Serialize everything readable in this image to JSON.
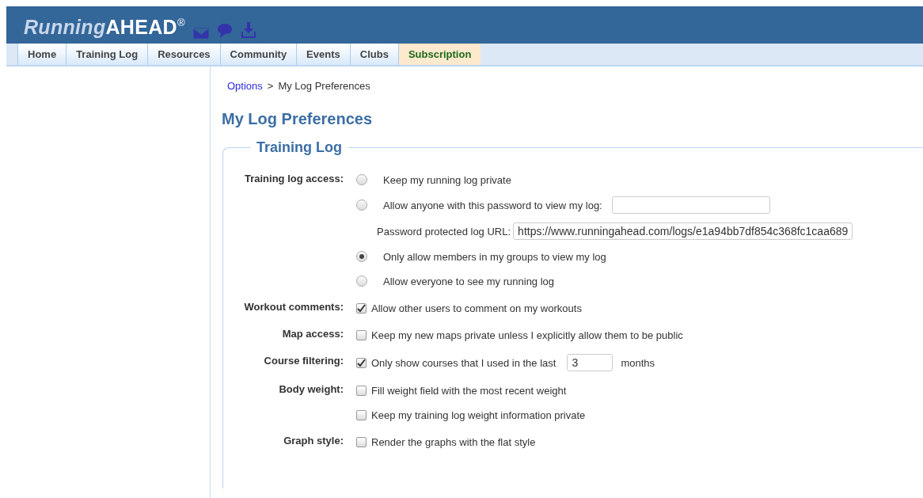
{
  "header": {
    "logo": {
      "first": "Running",
      "second": "AHEAD",
      "mark": "®"
    }
  },
  "nav": [
    {
      "label": "Home",
      "kind": "tab"
    },
    {
      "label": "Training Log",
      "kind": "tab"
    },
    {
      "label": "Resources",
      "kind": "tab"
    },
    {
      "label": "Community",
      "kind": "tab"
    },
    {
      "label": "Events",
      "kind": "tab"
    },
    {
      "label": "Clubs",
      "kind": "tab"
    },
    {
      "label": "Subscription",
      "kind": "promo"
    }
  ],
  "breadcrumb": {
    "link": "Options",
    "separator": ">",
    "current": "My Log Preferences"
  },
  "title": "My Log Preferences",
  "section": {
    "legend": "Training Log",
    "rows": [
      {
        "label": "Training log access:",
        "options": [
          {
            "kind": "radio",
            "text": "Keep my running log private",
            "selected": false
          },
          {
            "kind": "radio_field",
            "text": "Allow anyone with this password to view my log:",
            "selected": false
          },
          {
            "kind": "url",
            "text": "Password protected log URL:",
            "value": "https://www.runningahead.com/logs/e1a94bb7df854c368fc1caa689"
          },
          {
            "kind": "radio",
            "text": "Only allow members in my groups to view my log",
            "selected": true
          },
          {
            "kind": "radio",
            "text": "Allow everyone to see my running log",
            "selected": false
          }
        ]
      },
      {
        "label": "Workout comments:",
        "options": [
          {
            "kind": "checkbox",
            "text": "Allow other users to comment on my workouts",
            "checked": true
          }
        ]
      },
      {
        "label": "Map access:",
        "options": [
          {
            "kind": "checkbox",
            "text": "Keep my new maps private unless I explicitly allow them to be public",
            "checked": false
          }
        ]
      },
      {
        "label": "Course filtering:",
        "options": [
          {
            "kind": "checkbox_field",
            "text": "Only show courses that I used in the last",
            "checked": true,
            "value": "3",
            "suffix": "months"
          }
        ]
      },
      {
        "label": "Body weight:",
        "options": [
          {
            "kind": "checkbox",
            "text": "Fill weight field with the most recent weight",
            "checked": false
          },
          {
            "kind": "checkbox",
            "text": "Keep my training log weight information private",
            "checked": false
          }
        ]
      },
      {
        "label": "Graph style:",
        "options": [
          {
            "kind": "checkbox",
            "text": "Render the graphs with the flat style",
            "checked": false
          }
        ]
      }
    ]
  }
}
